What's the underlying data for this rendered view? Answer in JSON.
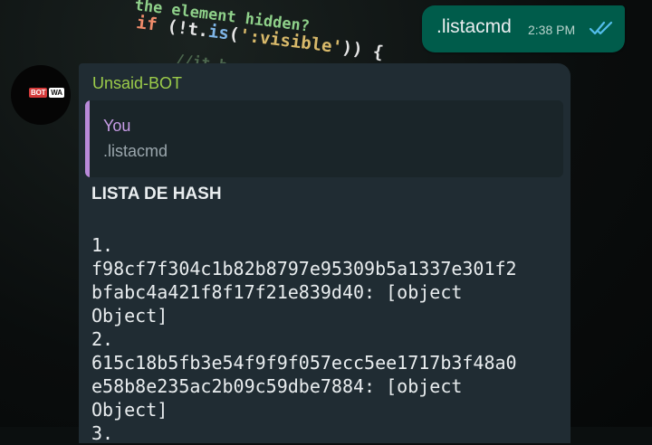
{
  "wallpaper": {
    "line1": "the element hidden?",
    "line2_kw": "if",
    "line2_pre": " (!t.",
    "line2_fn": "is",
    "line2_open": "(",
    "line2_str": "':visible'",
    "line2_close": ")) {",
    "line3": "//it h"
  },
  "sent_message": {
    "text": ".listacmd",
    "time": "2:38 PM",
    "status_icon": "double-check-read-icon"
  },
  "received_message": {
    "avatar_logo": [
      "BOT",
      "WA"
    ],
    "sender": "Unsaid-BOT",
    "quote": {
      "author": "You",
      "text": ".listacmd"
    },
    "title": "LISTA DE HASH",
    "items": [
      {
        "number": "1.",
        "hash_line1": "f98cf7f304c1b82b8797e95309b5a1337e301f2",
        "hash_line2": "bfabc4a421f8f17f21e839d40: [object",
        "hash_line3": "Object]"
      },
      {
        "number": "2.",
        "hash_line1": "615c18b5fb3e54f9f9f057ecc5ee1717b3f48a0",
        "hash_line2": "e58b8e235ac2b09c59dbe7884: [object",
        "hash_line3": "Object]"
      },
      {
        "number": "3.",
        "hash_line1": "",
        "hash_line2": "",
        "hash_line3": ""
      }
    ]
  },
  "colors": {
    "sent_bubble": "#005c4b",
    "received_bubble": "#202c33",
    "sender_name": "#9ccc4a",
    "quote_bar": "#b889d9",
    "read_ticks": "#53bdeb"
  }
}
